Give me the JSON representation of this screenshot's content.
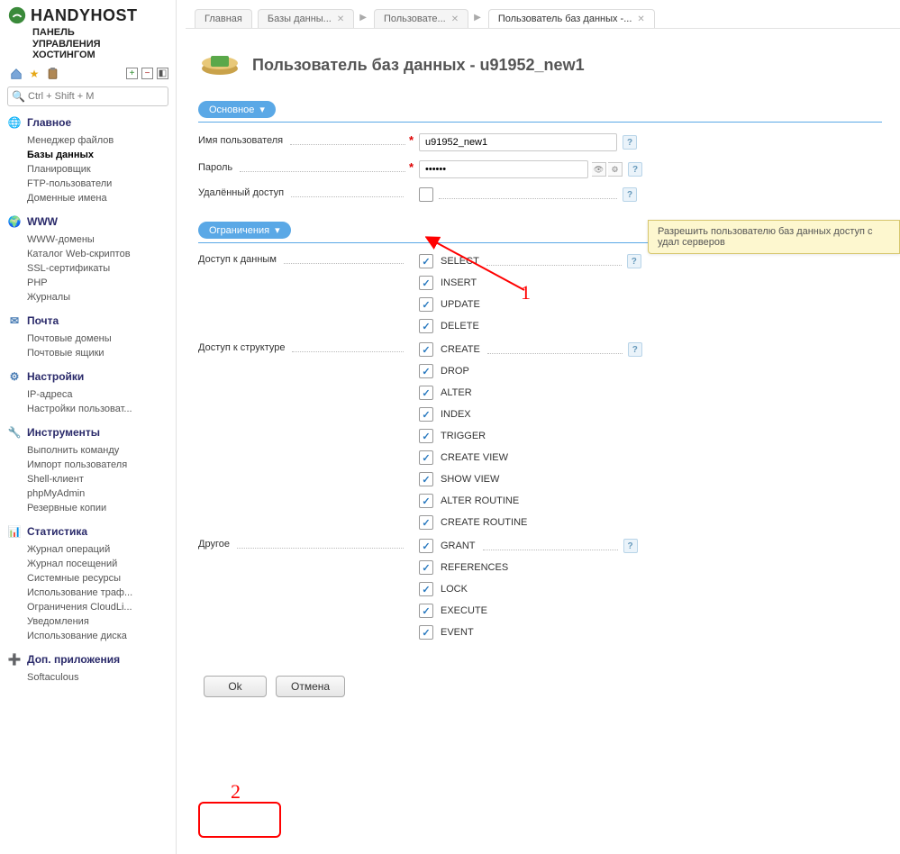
{
  "brand": {
    "name": "HANDYHOST",
    "subtitle_l1": "ПАНЕЛЬ",
    "subtitle_l2": "УПРАВЛЕНИЯ",
    "subtitle_l3": "ХОСТИНГОМ"
  },
  "search": {
    "placeholder": "Ctrl + Shift + M"
  },
  "nav": {
    "main": {
      "title": "Главное",
      "items": [
        "Менеджер файлов",
        "Базы данных",
        "Планировщик",
        "FTP-пользователи",
        "Доменные имена"
      ],
      "active": 1
    },
    "www": {
      "title": "WWW",
      "items": [
        "WWW-домены",
        "Каталог Web-скриптов",
        "SSL-сертификаты",
        "PHP",
        "Журналы"
      ]
    },
    "mail": {
      "title": "Почта",
      "items": [
        "Почтовые домены",
        "Почтовые ящики"
      ]
    },
    "set": {
      "title": "Настройки",
      "items": [
        "IP-адреса",
        "Настройки пользоват..."
      ]
    },
    "tools": {
      "title": "Инструменты",
      "items": [
        "Выполнить команду",
        "Импорт пользователя",
        "Shell-клиент",
        "phpMyAdmin",
        "Резервные копии"
      ]
    },
    "stats": {
      "title": "Статистика",
      "items": [
        "Журнал операций",
        "Журнал посещений",
        "Системные ресурсы",
        "Использование траф...",
        "Ограничения CloudLi...",
        "Уведомления",
        "Использование диска"
      ]
    },
    "apps": {
      "title": "Доп. приложения",
      "items": [
        "Softaculous"
      ]
    }
  },
  "tabs": {
    "t0": "Главная",
    "t1": "Базы данны...",
    "t2": "Пользовате...",
    "t3": "Пользователь баз данных -..."
  },
  "page": {
    "title": "Пользователь баз данных - u91952_new1"
  },
  "group": {
    "main": "Основное",
    "limits": "Ограничения"
  },
  "form": {
    "username_label": "Имя пользователя",
    "username_value": "u91952_new1",
    "password_label": "Пароль",
    "password_value": "••••••",
    "remote_label": "Удалённый доступ",
    "data_label": "Доступ к данным",
    "struct_label": "Доступ к структуре",
    "other_label": "Другое"
  },
  "perms_data": [
    "SELECT",
    "INSERT",
    "UPDATE",
    "DELETE"
  ],
  "perms_struct": [
    "CREATE",
    "DROP",
    "ALTER",
    "INDEX",
    "TRIGGER",
    "CREATE VIEW",
    "SHOW VIEW",
    "ALTER ROUTINE",
    "CREATE ROUTINE"
  ],
  "perms_other": [
    "GRANT",
    "REFERENCES",
    "LOCK",
    "EXECUTE",
    "EVENT"
  ],
  "buttons": {
    "ok": "Ok",
    "cancel": "Отмена"
  },
  "tooltip": "Разрешить пользователю баз данных доступ с удал серверов",
  "anno": {
    "n1": "1",
    "n2": "2"
  }
}
